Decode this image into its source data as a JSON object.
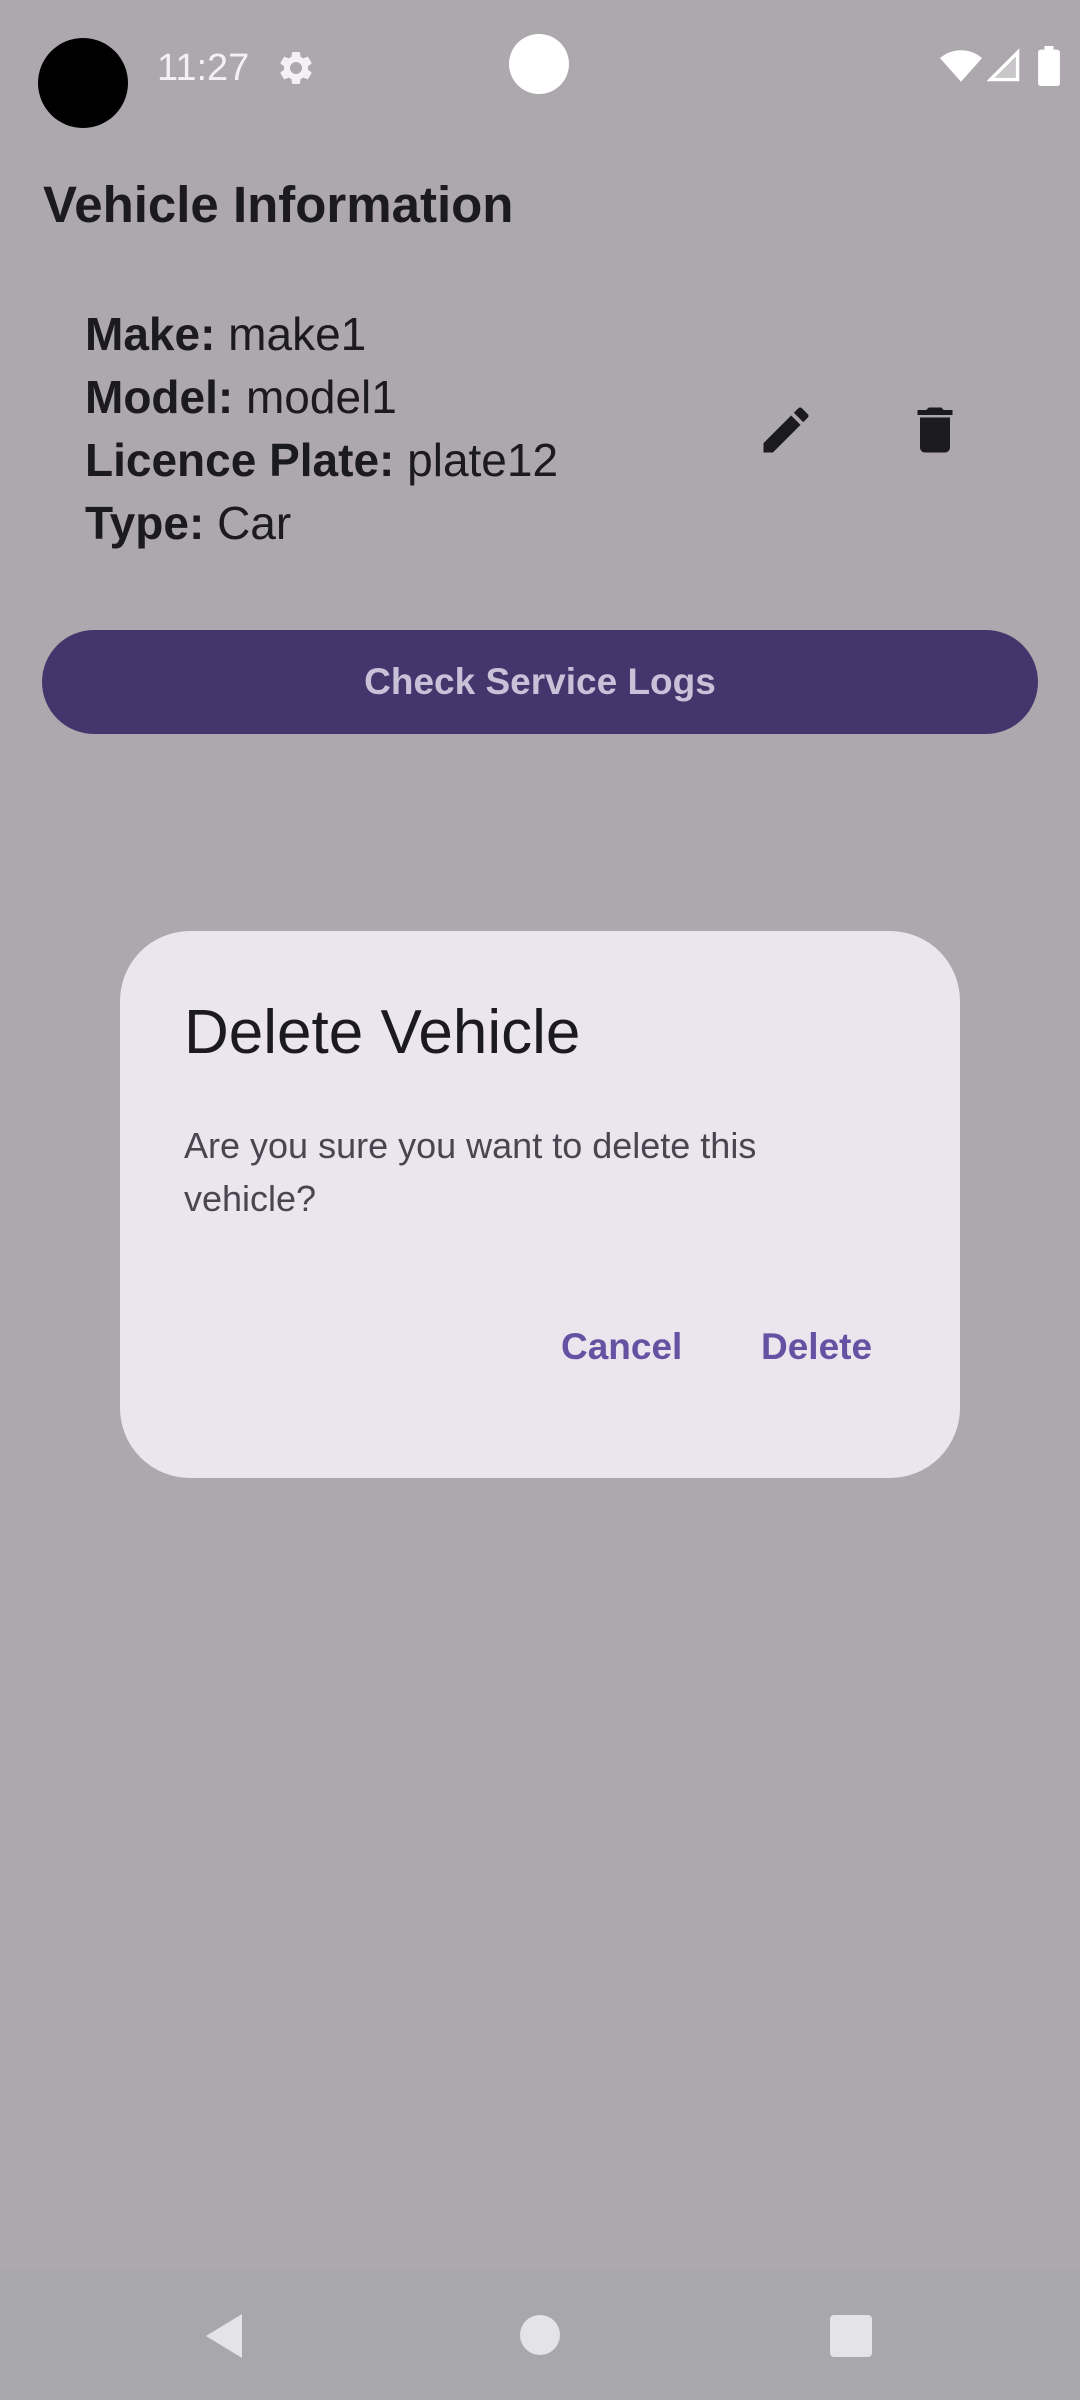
{
  "status_bar": {
    "time": "11:27",
    "icons": [
      "settings-icon",
      "wifi-icon",
      "signal-icon",
      "battery-icon"
    ]
  },
  "page": {
    "title": "Vehicle Information",
    "fields": [
      {
        "label": "Make:",
        "value": "make1"
      },
      {
        "label": "Model:",
        "value": "model1"
      },
      {
        "label": "Licence Plate:",
        "value": "plate12"
      },
      {
        "label": "Type:",
        "value": "Car"
      }
    ],
    "actions": [
      "edit-icon",
      "delete-icon"
    ],
    "service_button_label": "Check Service Logs"
  },
  "dialog": {
    "title": "Delete Vehicle",
    "message": "Are you sure you want to delete this vehicle?",
    "cancel_label": "Cancel",
    "confirm_label": "Delete"
  },
  "nav_bar": {
    "icons": [
      "back-icon",
      "home-icon",
      "recents-icon"
    ]
  },
  "colors": {
    "scrim_background": "#aca8ad",
    "primary_button": "#45356d",
    "dialog_surface": "#ebe5ee",
    "dialog_action": "#6652a3"
  }
}
